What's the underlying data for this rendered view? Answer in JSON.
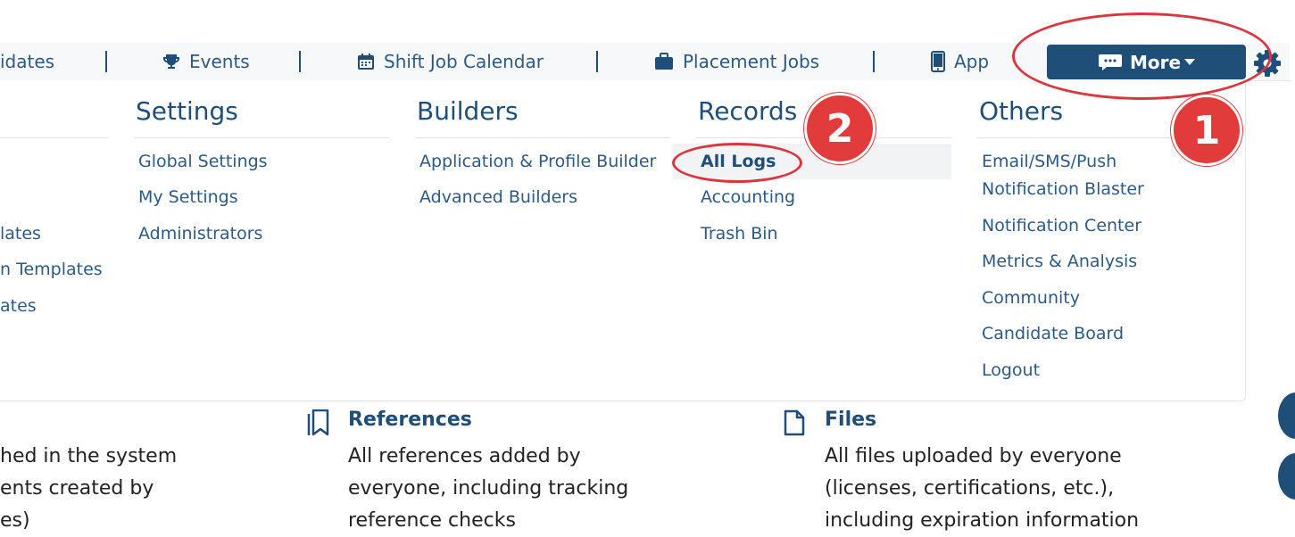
{
  "nav": {
    "items": [
      {
        "label": "idates"
      },
      {
        "label": "Events",
        "icon": "trophy-icon"
      },
      {
        "label": "Shift Job Calendar",
        "icon": "calendar-icon"
      },
      {
        "label": "Placement Jobs",
        "icon": "briefcase-icon"
      },
      {
        "label": "App",
        "icon": "mobile-icon"
      }
    ],
    "more_label": "More",
    "more_icon": "chat-icon"
  },
  "dropdown": {
    "left_column": [
      "lates",
      "n Templates",
      "ates"
    ],
    "columns": [
      {
        "title": "Settings",
        "links": [
          "Global Settings",
          "My Settings",
          "Administrators"
        ]
      },
      {
        "title": "Builders",
        "links": [
          "Application & Profile Builder",
          "Advanced Builders"
        ]
      },
      {
        "title": "Records",
        "links": [
          "All Logs",
          "Accounting",
          "Trash Bin"
        ]
      },
      {
        "title": "Others",
        "links": [
          "Email/SMS/Push",
          "Notification Blaster",
          "Notification Center",
          "Metrics & Analysis",
          "Community",
          "Candidate Board",
          "Logout"
        ]
      }
    ]
  },
  "annotations": {
    "badge1": "1",
    "badge2": "2",
    "color": "#e23b3b"
  },
  "lower": {
    "left_lines": [
      "hed in the system",
      "ents created by",
      "es)"
    ],
    "references": {
      "title": "References",
      "lines": [
        "All references added by",
        "everyone, including tracking",
        "reference checks"
      ]
    },
    "files": {
      "title": "Files",
      "lines": [
        "All files uploaded by everyone",
        "(licenses, certifications, etc.),",
        "including expiration information"
      ]
    }
  },
  "colors": {
    "primary": "#1f4e79",
    "link": "#2c5a85",
    "accent_red": "#d9363e"
  }
}
